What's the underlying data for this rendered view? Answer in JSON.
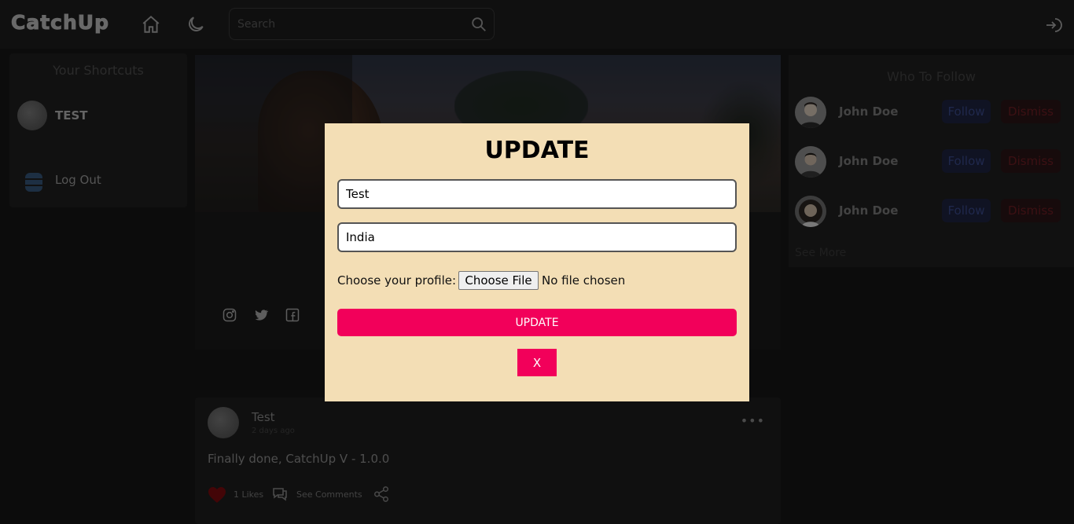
{
  "header": {
    "logo": "CatchUp",
    "search_placeholder": "Search",
    "icons": [
      "home-icon",
      "moon-icon",
      "search-icon",
      "logout-icon"
    ]
  },
  "left_sidebar": {
    "title": "Your Shortcuts",
    "profile_name": "TEST",
    "logout_label": "Log Out"
  },
  "profile": {
    "social_icons": [
      "instagram-icon",
      "twitter-icon",
      "facebook-icon"
    ]
  },
  "post": {
    "author": "Test",
    "time": "2 days ago",
    "text": "Finally done, CatchUp V - 1.0.0",
    "likes": "1 Likes",
    "comments_label": "See Comments"
  },
  "right_sidebar": {
    "title": "Who To Follow",
    "users": [
      {
        "name": "John Doe",
        "follow": "Follow",
        "dismiss": "Dismiss"
      },
      {
        "name": "John Doe",
        "follow": "Follow",
        "dismiss": "Dismiss"
      },
      {
        "name": "John Doe",
        "follow": "Follow",
        "dismiss": "Dismiss"
      }
    ],
    "see_more": "See More"
  },
  "modal": {
    "title": "UPDATE",
    "name_value": "Test",
    "country_value": "India",
    "file_label": "Choose your profile:",
    "file_button": "Choose File",
    "file_status": "No file chosen",
    "update_button": "UPDATE",
    "close_button": "X"
  },
  "colors": {
    "accent": "#f2005a",
    "modal_bg": "#f3deb5",
    "follow": "#1e2340",
    "dismiss": "#2a1517"
  }
}
